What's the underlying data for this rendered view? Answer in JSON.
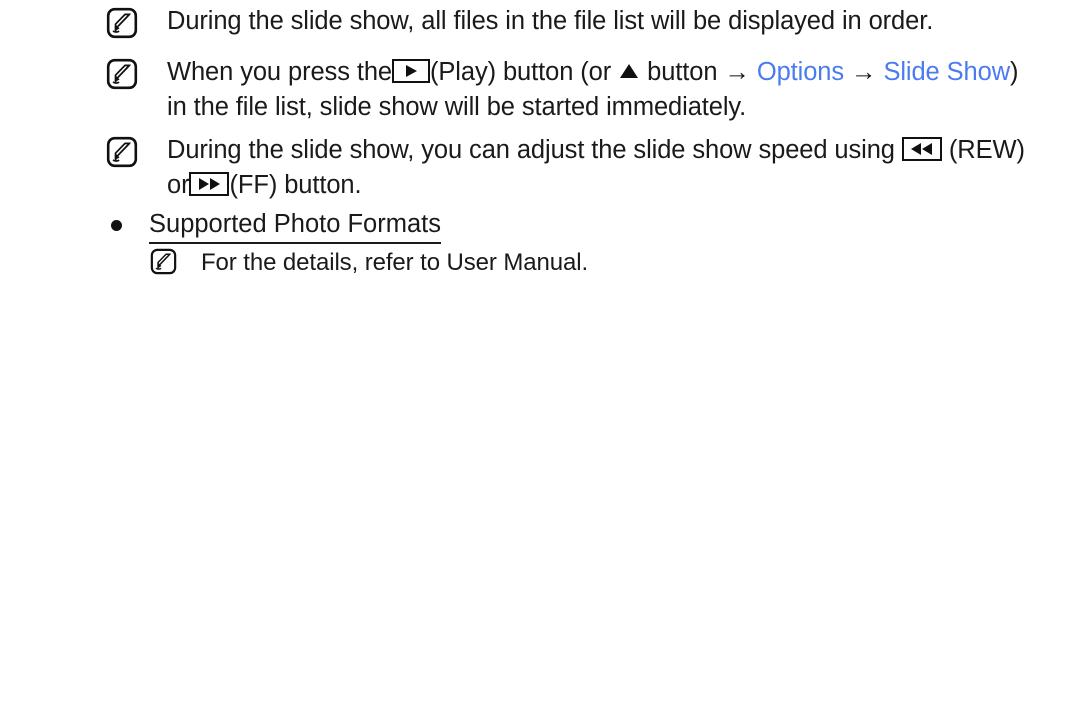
{
  "document": {
    "type": "user-manual-page",
    "background_color": "#ffffff",
    "text_color": "#1a1a1a",
    "link_color": "#4b7bf0"
  },
  "notes": [
    {
      "icon": "note-memo-icon",
      "text_before": "During the slide show, all files in the file list will be displayed in order."
    },
    {
      "icon": "note-memo-icon",
      "seg1": "When you press the ",
      "key1": "play-button-icon",
      "seg2": " (Play) button (or ",
      "key2": "up-arrow-icon",
      "seg3": " button ",
      "arrow1": "→",
      "link1": "Options",
      "arrow2": "→",
      "link2": "Slide Show",
      "seg4": ") in the file list, slide show will be started immediately."
    },
    {
      "icon": "note-memo-icon",
      "seg1": "During the slide show, you can adjust the slide show speed using ",
      "key1": "rewind-button-icon",
      "seg2": " (REW) or ",
      "key2": "fast-forward-button-icon",
      "seg3": " (FF) button."
    }
  ],
  "bullet_heading": {
    "bullet": "●",
    "label": "Supported Photo Formats",
    "underlined": true
  },
  "sub_note": {
    "icon": "note-memo-icon",
    "text": "For the details, refer to User Manual."
  },
  "glyphs": {
    "arrow_right": "→",
    "triangle_up": "▲",
    "play": "▶",
    "rewind": "◀◀",
    "fast_forward": "▶▶"
  },
  "text_fragments": {
    "note1_full": "During the slide show, all files in the file list will be displayed in order.",
    "note2_part_a": "When you press the",
    "note2_part_b": "(Play) button (or",
    "note2_part_c": "button",
    "note2_link_options": "Options",
    "note2_link_slide": "Slide",
    "note2_link_show": "Show",
    "note2_part_d": ") in the file list, slide show will be started immediately.",
    "note3_part_a": "During the slide show, you can adjust the slide show speed using",
    "note3_part_b": "(REW)",
    "note3_part_c": "or",
    "note3_part_d": "(FF) button.",
    "bullet_label": "Supported Photo Formats",
    "subnote_text": "For the details, refer to User Manual."
  }
}
